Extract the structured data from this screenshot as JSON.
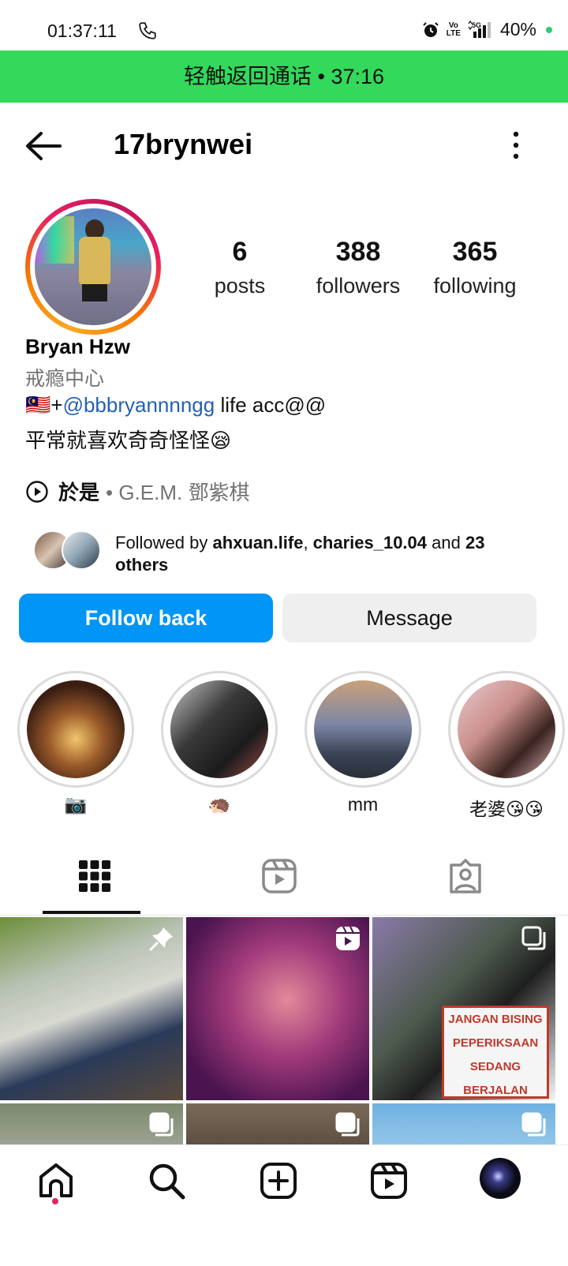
{
  "status_bar": {
    "time": "01:37:11",
    "network": "5G",
    "volte": "Vo\nLTE",
    "battery": "40%"
  },
  "call_banner": "轻触返回通话 • 37:16",
  "header": {
    "username": "17brynwei"
  },
  "profile": {
    "posts_count": "6",
    "posts_label": "posts",
    "followers_count": "388",
    "followers_label": "followers",
    "following_count": "365",
    "following_label": "following",
    "full_name": "Bryan Hzw",
    "category": "戒瘾中心",
    "bio_prefix": "🇲🇾+",
    "bio_mention": "@bbbryannnngg",
    "bio_suffix": " life acc@@",
    "bio_line2": "平常就喜欢奇奇怪怪😪",
    "music_song": "於是",
    "music_artist": "• G.E.M. 鄧紫棋",
    "followed_by_prefix": "Followed by ",
    "followed_by_user1": "ahxuan.life",
    "followed_by_sep": ", ",
    "followed_by_user2": "charies_10.04",
    "followed_by_and": " and ",
    "followed_by_others": "23 others"
  },
  "actions": {
    "follow_back": "Follow back",
    "message": "Message"
  },
  "highlights": [
    {
      "label": "📷"
    },
    {
      "label": "🦔"
    },
    {
      "label": "mm"
    },
    {
      "label": "老婆😘😘"
    }
  ],
  "post_sign": {
    "line1": "JANGAN BISING",
    "line2": "PEPERIKSAAN",
    "line3": "SEDANG BERJALAN"
  },
  "colors": {
    "call_banner": "#33d95a",
    "follow_button": "#0095f6",
    "mention": "#2361b3"
  }
}
